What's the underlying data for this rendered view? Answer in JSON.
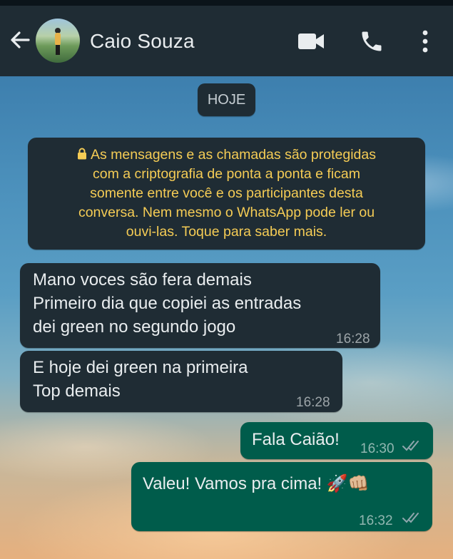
{
  "header": {
    "contact_name": "Caio Souza",
    "back_icon": "arrow-left-icon",
    "video_icon": "video-camera-icon",
    "call_icon": "phone-icon",
    "menu_icon": "more-vertical-icon"
  },
  "chat": {
    "date_chip": "HOJE",
    "encryption_notice": {
      "icon": "lock-icon",
      "lines": [
        "As mensagens e as chamadas são protegidas",
        "com a criptografia de ponta a ponta e ficam",
        "somente entre você e os participantes desta",
        "conversa. Nem mesmo o WhatsApp pode ler ou",
        "ouvi-las. Toque para saber mais."
      ]
    },
    "messages": [
      {
        "direction": "incoming",
        "lines": [
          "Mano voces são fera demais",
          "Primeiro dia que copiei as entradas",
          "dei green no segundo jogo"
        ],
        "time": "16:28"
      },
      {
        "direction": "incoming",
        "lines": [
          "E hoje dei green na primeira",
          "Top demais"
        ],
        "time": "16:28"
      },
      {
        "direction": "outgoing",
        "lines": [
          "Fala Caião!"
        ],
        "time": "16:30",
        "status": "read"
      },
      {
        "direction": "outgoing",
        "lines": [
          "Valeu! Vamos pra cima! 🚀👊🏼"
        ],
        "time": "16:32",
        "status": "read"
      }
    ]
  },
  "colors": {
    "header_bg": "#1f2c34",
    "incoming_bubble": "#1f2c34",
    "outgoing_bubble": "#005c4b",
    "notice_text": "#f5cc55",
    "read_ticks": "#8696a0"
  }
}
